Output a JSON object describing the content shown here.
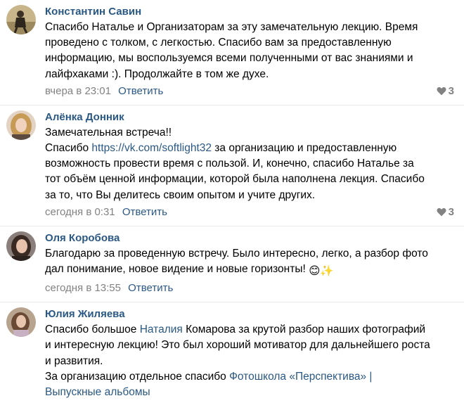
{
  "comments": [
    {
      "author": "Константин Савин",
      "lines": [
        "Спасибо Наталье и Организаторам за эту замечательную лекцию. Время",
        "проведено с толком, с легкостью. Спасибо вам за предоставленную",
        "информацию, мы воспользуемся всеми полученными от вас знаниями и",
        "лайфхаками :). Продолжайте в том же духе."
      ],
      "time": "вчера в 23:01",
      "reply": "Ответить",
      "likes": "3"
    },
    {
      "author": "Алёнка Донник",
      "line1": "Замечательная встреча!!",
      "line2_pre": "Спасибо ",
      "line2_link": "https://vk.com/softlight32",
      "line2_post": " за организацию и предоставленную",
      "lines": [
        "возможность провести время с пользой. И, конечно, спасибо Наталье за",
        "тот объём ценной информации, которой была наполнена лекция. Спасибо",
        "за то, что Вы делитесь своим опытом и учите других."
      ],
      "time": "сегодня в 0:31",
      "reply": "Ответить",
      "likes": "3"
    },
    {
      "author": "Оля Коробова",
      "lines": [
        "Благодарю за проведенную встречу. Было интересно, легко, а разбор фото",
        "дал понимание, новое видение и новые горизонты! "
      ],
      "emoji": "😊✨",
      "time": "сегодня в 13:55",
      "reply": "Ответить"
    },
    {
      "author": "Юлия Жиляева",
      "line1_pre": "Спасибо большое ",
      "line1_link": "Наталия",
      "line1_post": " Комарова за крутой разбор наших фотографий",
      "lines": [
        "и интересную лекцию! Это был хороший мотиватор для дальнейшего роста",
        "и развития."
      ],
      "last_pre": "За организацию отдельное спасибо ",
      "last_link1": "Фотошкола «Перспектива» |",
      "last_link2": "Выпускные альбомы"
    }
  ]
}
